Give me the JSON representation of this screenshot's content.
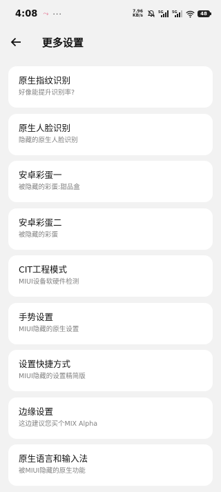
{
  "status_bar": {
    "time": "4:08",
    "notification_dots": "···",
    "speed_value": "7.96",
    "speed_unit": "KB/s",
    "signal1_label": "5G",
    "signal2_label": "5G",
    "battery": "48",
    "notification_icon": "signal-swirl-icon",
    "mute_icon": "mute-icon",
    "wifi_icon": "wifi-icon"
  },
  "header": {
    "title": "更多设置",
    "back_icon": "back-arrow-icon"
  },
  "items": [
    {
      "title": "原生指纹识别",
      "subtitle": "好像能提升识别率?"
    },
    {
      "title": "原生人脸识别",
      "subtitle": "隐藏的原生人脸识别"
    },
    {
      "title": "安卓彩蛋一",
      "subtitle": "被隐藏的彩蛋:甜品盒"
    },
    {
      "title": "安卓彩蛋二",
      "subtitle": "被隐藏的彩蛋"
    },
    {
      "title": "CIT工程模式",
      "subtitle": "MIUI设备软硬件检测"
    },
    {
      "title": "手势设置",
      "subtitle": "MIUI隐藏的原生设置"
    },
    {
      "title": "设置快捷方式",
      "subtitle": "MIUI隐藏的设置精简版"
    },
    {
      "title": "边缘设置",
      "subtitle": "这边建议您买个MIX Alpha"
    },
    {
      "title": "原生语言和输入法",
      "subtitle": "被MIUI隐藏的原生功能"
    }
  ],
  "colors": {
    "background": "#f2f2f2",
    "card": "#ffffff",
    "subtitle": "#808080",
    "notification_accent": "#e26b8a"
  }
}
